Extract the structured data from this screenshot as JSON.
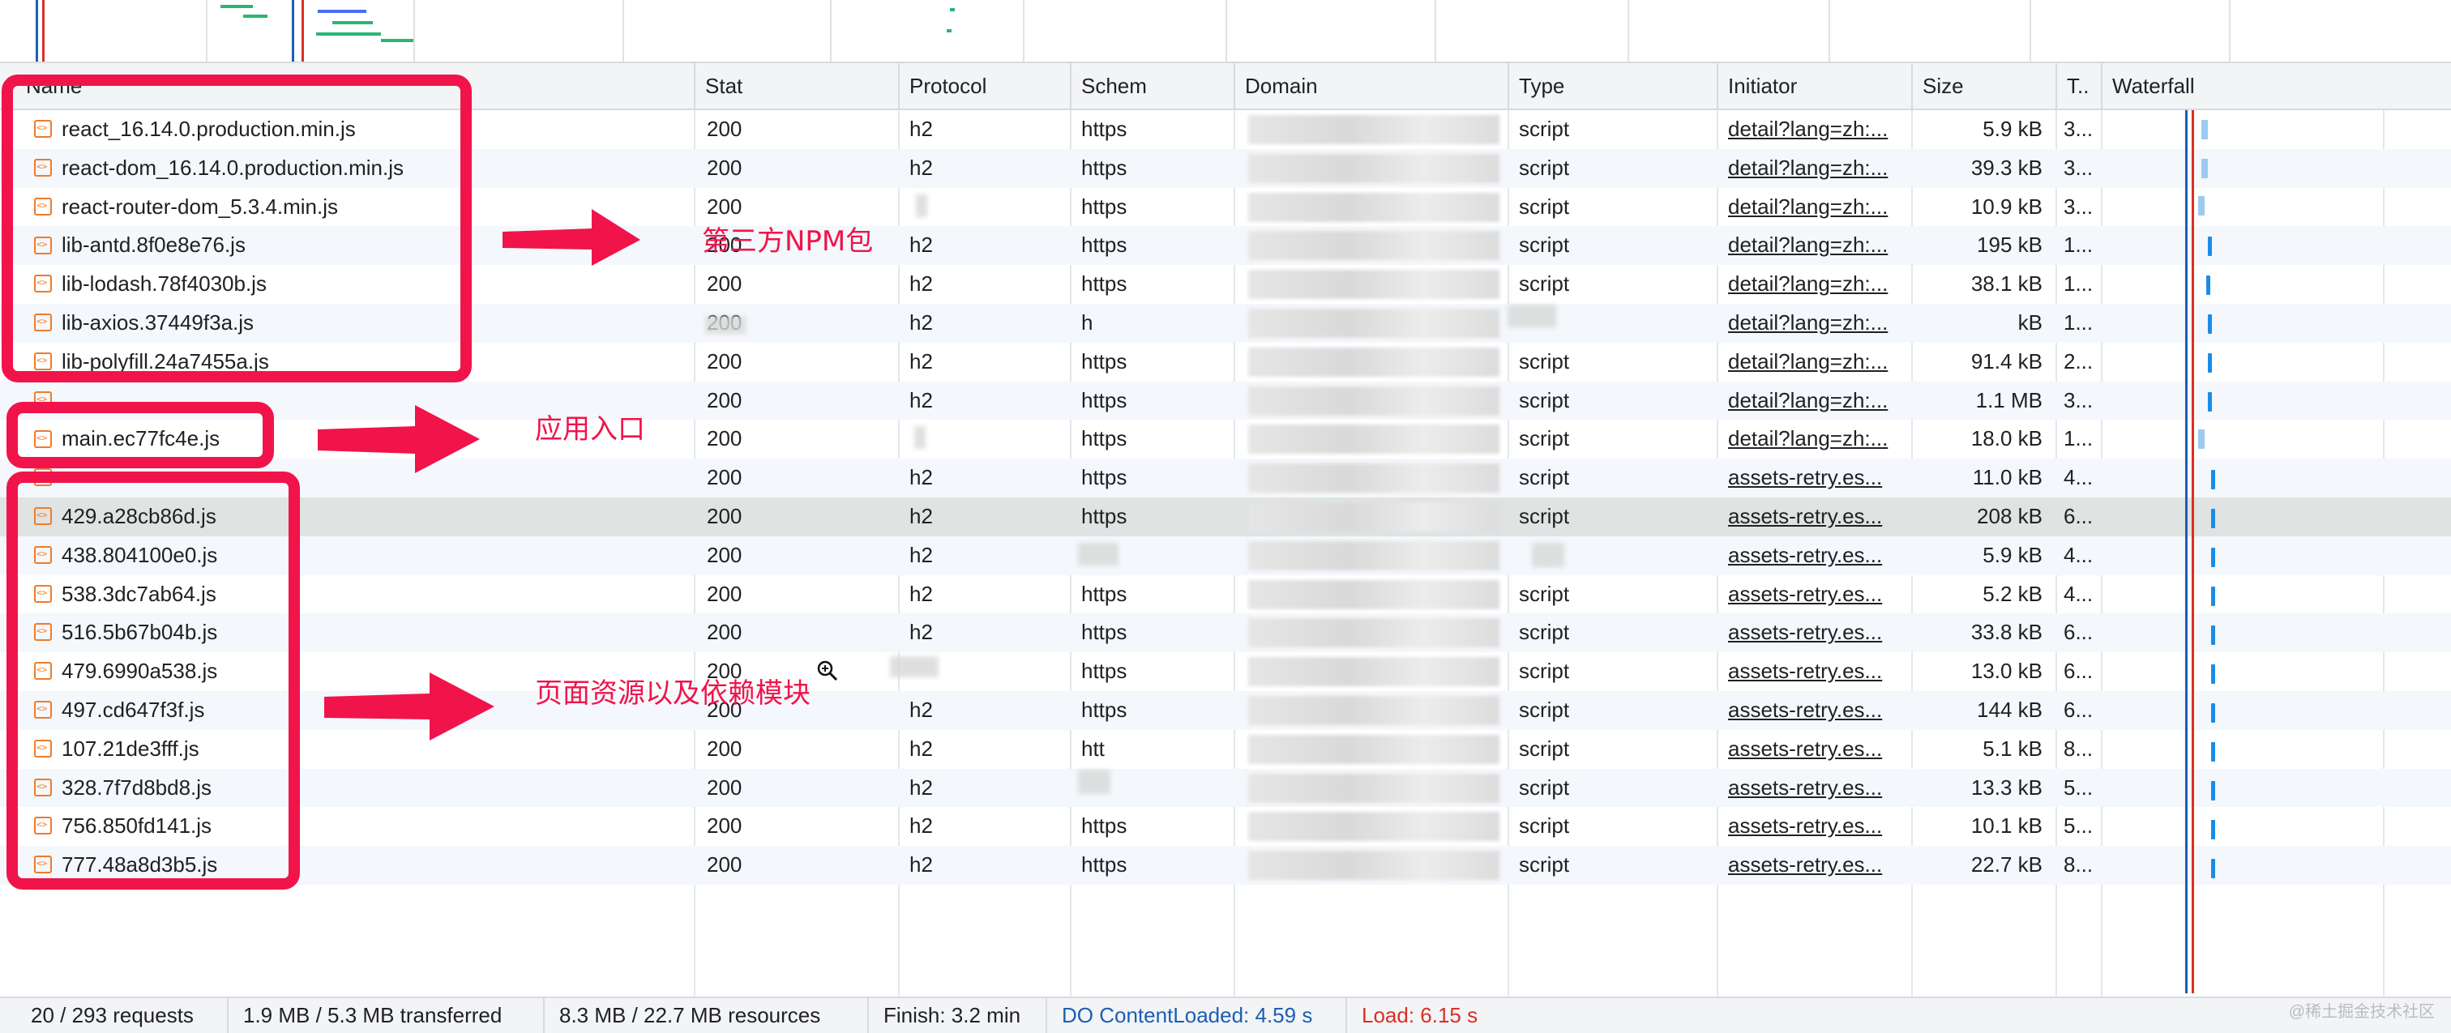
{
  "columns": {
    "name": "Name",
    "status": "Stat",
    "protocol": "Protocol",
    "scheme": "Schem",
    "domain": "Domain",
    "type": "Type",
    "initiator": "Initiator",
    "size": "Size",
    "time": "T..",
    "waterfall": "Waterfall"
  },
  "rows": [
    {
      "name": "react_16.14.0.production.min.js",
      "status": "200",
      "protocol": "h2",
      "scheme": "https",
      "type": "script",
      "initiator": "detail?lang=zh:...",
      "size": "5.9 kB",
      "time": "3..."
    },
    {
      "name": "react-dom_16.14.0.production.min.js",
      "status": "200",
      "protocol": "h2",
      "scheme": "https",
      "type": "script",
      "initiator": "detail?lang=zh:...",
      "size": "39.3 kB",
      "time": "3..."
    },
    {
      "name": "react-router-dom_5.3.4.min.js",
      "status": "200",
      "protocol": "",
      "scheme": "https",
      "type": "script",
      "initiator": "detail?lang=zh:...",
      "size": "10.9 kB",
      "time": "3..."
    },
    {
      "name": "lib-antd.8f0e8e76.js",
      "status": "200",
      "protocol": "h2",
      "scheme": "https",
      "type": "script",
      "initiator": "detail?lang=zh:...",
      "size": "195 kB",
      "time": "1..."
    },
    {
      "name": "lib-lodash.78f4030b.js",
      "status": "200",
      "protocol": "h2",
      "scheme": "https",
      "type": "script",
      "initiator": "detail?lang=zh:...",
      "size": "38.1 kB",
      "time": "1..."
    },
    {
      "name": "lib-axios.37449f3a.js",
      "status": "200",
      "protocol": "h2",
      "scheme": "h",
      "type": "",
      "initiator": "detail?lang=zh:...",
      "size": "kB",
      "time": "1..."
    },
    {
      "name": "lib-polyfill.24a7455a.js",
      "status": "200",
      "protocol": "h2",
      "scheme": "https",
      "type": "script",
      "initiator": "detail?lang=zh:...",
      "size": "91.4 kB",
      "time": "2..."
    },
    {
      "name": "",
      "status": "200",
      "protocol": "h2",
      "scheme": "https",
      "type": "script",
      "initiator": "detail?lang=zh:...",
      "size": "1.1 MB",
      "time": "3..."
    },
    {
      "name": "main.ec77fc4e.js",
      "status": "200",
      "protocol": "",
      "scheme": "https",
      "type": "script",
      "initiator": "detail?lang=zh:...",
      "size": "18.0 kB",
      "time": "1..."
    },
    {
      "name": "",
      "status": "200",
      "protocol": "h2",
      "scheme": "https",
      "type": "script",
      "initiator": "assets-retry.es...",
      "size": "11.0 kB",
      "time": "4..."
    },
    {
      "name": "429.a28cb86d.js",
      "status": "200",
      "protocol": "h2",
      "scheme": "https",
      "type": "script",
      "initiator": "assets-retry.es...",
      "size": "208 kB",
      "time": "6..."
    },
    {
      "name": "438.804100e0.js",
      "status": "200",
      "protocol": "h2",
      "scheme": "",
      "type": "",
      "initiator": "assets-retry.es...",
      "size": "5.9 kB",
      "time": "4..."
    },
    {
      "name": "538.3dc7ab64.js",
      "status": "200",
      "protocol": "h2",
      "scheme": "https",
      "type": "script",
      "initiator": "assets-retry.es...",
      "size": "5.2 kB",
      "time": "4..."
    },
    {
      "name": "516.5b67b04b.js",
      "status": "200",
      "protocol": "h2",
      "scheme": "https",
      "type": "script",
      "initiator": "assets-retry.es...",
      "size": "33.8 kB",
      "time": "6..."
    },
    {
      "name": "479.6990a538.js",
      "status": "200",
      "protocol": "",
      "scheme": "https",
      "type": "script",
      "initiator": "assets-retry.es...",
      "size": "13.0 kB",
      "time": "6..."
    },
    {
      "name": "497.cd647f3f.js",
      "status": "200",
      "protocol": "h2",
      "scheme": "https",
      "type": "script",
      "initiator": "assets-retry.es...",
      "size": "144 kB",
      "time": "6..."
    },
    {
      "name": "107.21de3fff.js",
      "status": "200",
      "protocol": "h2",
      "scheme": "htt",
      "type": "script",
      "initiator": "assets-retry.es...",
      "size": "5.1 kB",
      "time": "8..."
    },
    {
      "name": "328.7f7d8bd8.js",
      "status": "200",
      "protocol": "h2",
      "scheme": "",
      "type": "script",
      "initiator": "assets-retry.es...",
      "size": "13.3 kB",
      "time": "5..."
    },
    {
      "name": "756.850fd141.js",
      "status": "200",
      "protocol": "h2",
      "scheme": "https",
      "type": "script",
      "initiator": "assets-retry.es...",
      "size": "10.1 kB",
      "time": "5..."
    },
    {
      "name": "777.48a8d3b5.js",
      "status": "200",
      "protocol": "h2",
      "scheme": "https",
      "type": "script",
      "initiator": "assets-retry.es...",
      "size": "22.7 kB",
      "time": "8..."
    }
  ],
  "footer": {
    "requests": "20 / 293 requests",
    "transferred": "1.9 MB / 5.3 MB transferred",
    "resources": "8.3 MB / 22.7 MB resources",
    "finish": "Finish: 3.2 min",
    "dcl": "DO  ContentLoaded: 4.59 s",
    "load": "Load: 6.15 s"
  },
  "annotations": {
    "npm": "第三方NPM包",
    "entry": "应用入口",
    "page": "页面资源以及依赖模块"
  },
  "watermark": "@稀土掘金技术社区",
  "colors": {
    "annotation": "#f0144a",
    "dcl": "#1a5fb4",
    "load": "#d93025",
    "waterfall_bar": "#1a8ce8"
  }
}
